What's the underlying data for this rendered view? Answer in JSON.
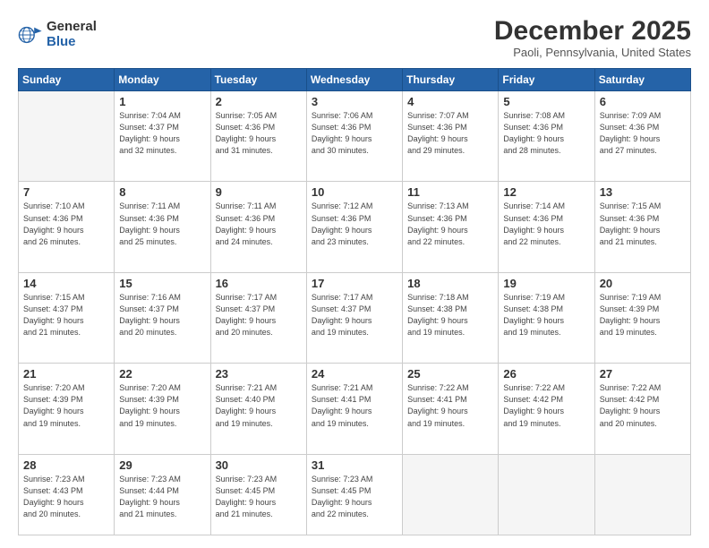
{
  "logo": {
    "general": "General",
    "blue": "Blue"
  },
  "title": "December 2025",
  "location": "Paoli, Pennsylvania, United States",
  "days_header": [
    "Sunday",
    "Monday",
    "Tuesday",
    "Wednesday",
    "Thursday",
    "Friday",
    "Saturday"
  ],
  "weeks": [
    [
      {
        "num": "",
        "info": ""
      },
      {
        "num": "1",
        "info": "Sunrise: 7:04 AM\nSunset: 4:37 PM\nDaylight: 9 hours\nand 32 minutes."
      },
      {
        "num": "2",
        "info": "Sunrise: 7:05 AM\nSunset: 4:36 PM\nDaylight: 9 hours\nand 31 minutes."
      },
      {
        "num": "3",
        "info": "Sunrise: 7:06 AM\nSunset: 4:36 PM\nDaylight: 9 hours\nand 30 minutes."
      },
      {
        "num": "4",
        "info": "Sunrise: 7:07 AM\nSunset: 4:36 PM\nDaylight: 9 hours\nand 29 minutes."
      },
      {
        "num": "5",
        "info": "Sunrise: 7:08 AM\nSunset: 4:36 PM\nDaylight: 9 hours\nand 28 minutes."
      },
      {
        "num": "6",
        "info": "Sunrise: 7:09 AM\nSunset: 4:36 PM\nDaylight: 9 hours\nand 27 minutes."
      }
    ],
    [
      {
        "num": "7",
        "info": "Sunrise: 7:10 AM\nSunset: 4:36 PM\nDaylight: 9 hours\nand 26 minutes."
      },
      {
        "num": "8",
        "info": "Sunrise: 7:11 AM\nSunset: 4:36 PM\nDaylight: 9 hours\nand 25 minutes."
      },
      {
        "num": "9",
        "info": "Sunrise: 7:11 AM\nSunset: 4:36 PM\nDaylight: 9 hours\nand 24 minutes."
      },
      {
        "num": "10",
        "info": "Sunrise: 7:12 AM\nSunset: 4:36 PM\nDaylight: 9 hours\nand 23 minutes."
      },
      {
        "num": "11",
        "info": "Sunrise: 7:13 AM\nSunset: 4:36 PM\nDaylight: 9 hours\nand 22 minutes."
      },
      {
        "num": "12",
        "info": "Sunrise: 7:14 AM\nSunset: 4:36 PM\nDaylight: 9 hours\nand 22 minutes."
      },
      {
        "num": "13",
        "info": "Sunrise: 7:15 AM\nSunset: 4:36 PM\nDaylight: 9 hours\nand 21 minutes."
      }
    ],
    [
      {
        "num": "14",
        "info": "Sunrise: 7:15 AM\nSunset: 4:37 PM\nDaylight: 9 hours\nand 21 minutes."
      },
      {
        "num": "15",
        "info": "Sunrise: 7:16 AM\nSunset: 4:37 PM\nDaylight: 9 hours\nand 20 minutes."
      },
      {
        "num": "16",
        "info": "Sunrise: 7:17 AM\nSunset: 4:37 PM\nDaylight: 9 hours\nand 20 minutes."
      },
      {
        "num": "17",
        "info": "Sunrise: 7:17 AM\nSunset: 4:37 PM\nDaylight: 9 hours\nand 19 minutes."
      },
      {
        "num": "18",
        "info": "Sunrise: 7:18 AM\nSunset: 4:38 PM\nDaylight: 9 hours\nand 19 minutes."
      },
      {
        "num": "19",
        "info": "Sunrise: 7:19 AM\nSunset: 4:38 PM\nDaylight: 9 hours\nand 19 minutes."
      },
      {
        "num": "20",
        "info": "Sunrise: 7:19 AM\nSunset: 4:39 PM\nDaylight: 9 hours\nand 19 minutes."
      }
    ],
    [
      {
        "num": "21",
        "info": "Sunrise: 7:20 AM\nSunset: 4:39 PM\nDaylight: 9 hours\nand 19 minutes."
      },
      {
        "num": "22",
        "info": "Sunrise: 7:20 AM\nSunset: 4:39 PM\nDaylight: 9 hours\nand 19 minutes."
      },
      {
        "num": "23",
        "info": "Sunrise: 7:21 AM\nSunset: 4:40 PM\nDaylight: 9 hours\nand 19 minutes."
      },
      {
        "num": "24",
        "info": "Sunrise: 7:21 AM\nSunset: 4:41 PM\nDaylight: 9 hours\nand 19 minutes."
      },
      {
        "num": "25",
        "info": "Sunrise: 7:22 AM\nSunset: 4:41 PM\nDaylight: 9 hours\nand 19 minutes."
      },
      {
        "num": "26",
        "info": "Sunrise: 7:22 AM\nSunset: 4:42 PM\nDaylight: 9 hours\nand 19 minutes."
      },
      {
        "num": "27",
        "info": "Sunrise: 7:22 AM\nSunset: 4:42 PM\nDaylight: 9 hours\nand 20 minutes."
      }
    ],
    [
      {
        "num": "28",
        "info": "Sunrise: 7:23 AM\nSunset: 4:43 PM\nDaylight: 9 hours\nand 20 minutes."
      },
      {
        "num": "29",
        "info": "Sunrise: 7:23 AM\nSunset: 4:44 PM\nDaylight: 9 hours\nand 21 minutes."
      },
      {
        "num": "30",
        "info": "Sunrise: 7:23 AM\nSunset: 4:45 PM\nDaylight: 9 hours\nand 21 minutes."
      },
      {
        "num": "31",
        "info": "Sunrise: 7:23 AM\nSunset: 4:45 PM\nDaylight: 9 hours\nand 22 minutes."
      },
      {
        "num": "",
        "info": ""
      },
      {
        "num": "",
        "info": ""
      },
      {
        "num": "",
        "info": ""
      }
    ]
  ]
}
